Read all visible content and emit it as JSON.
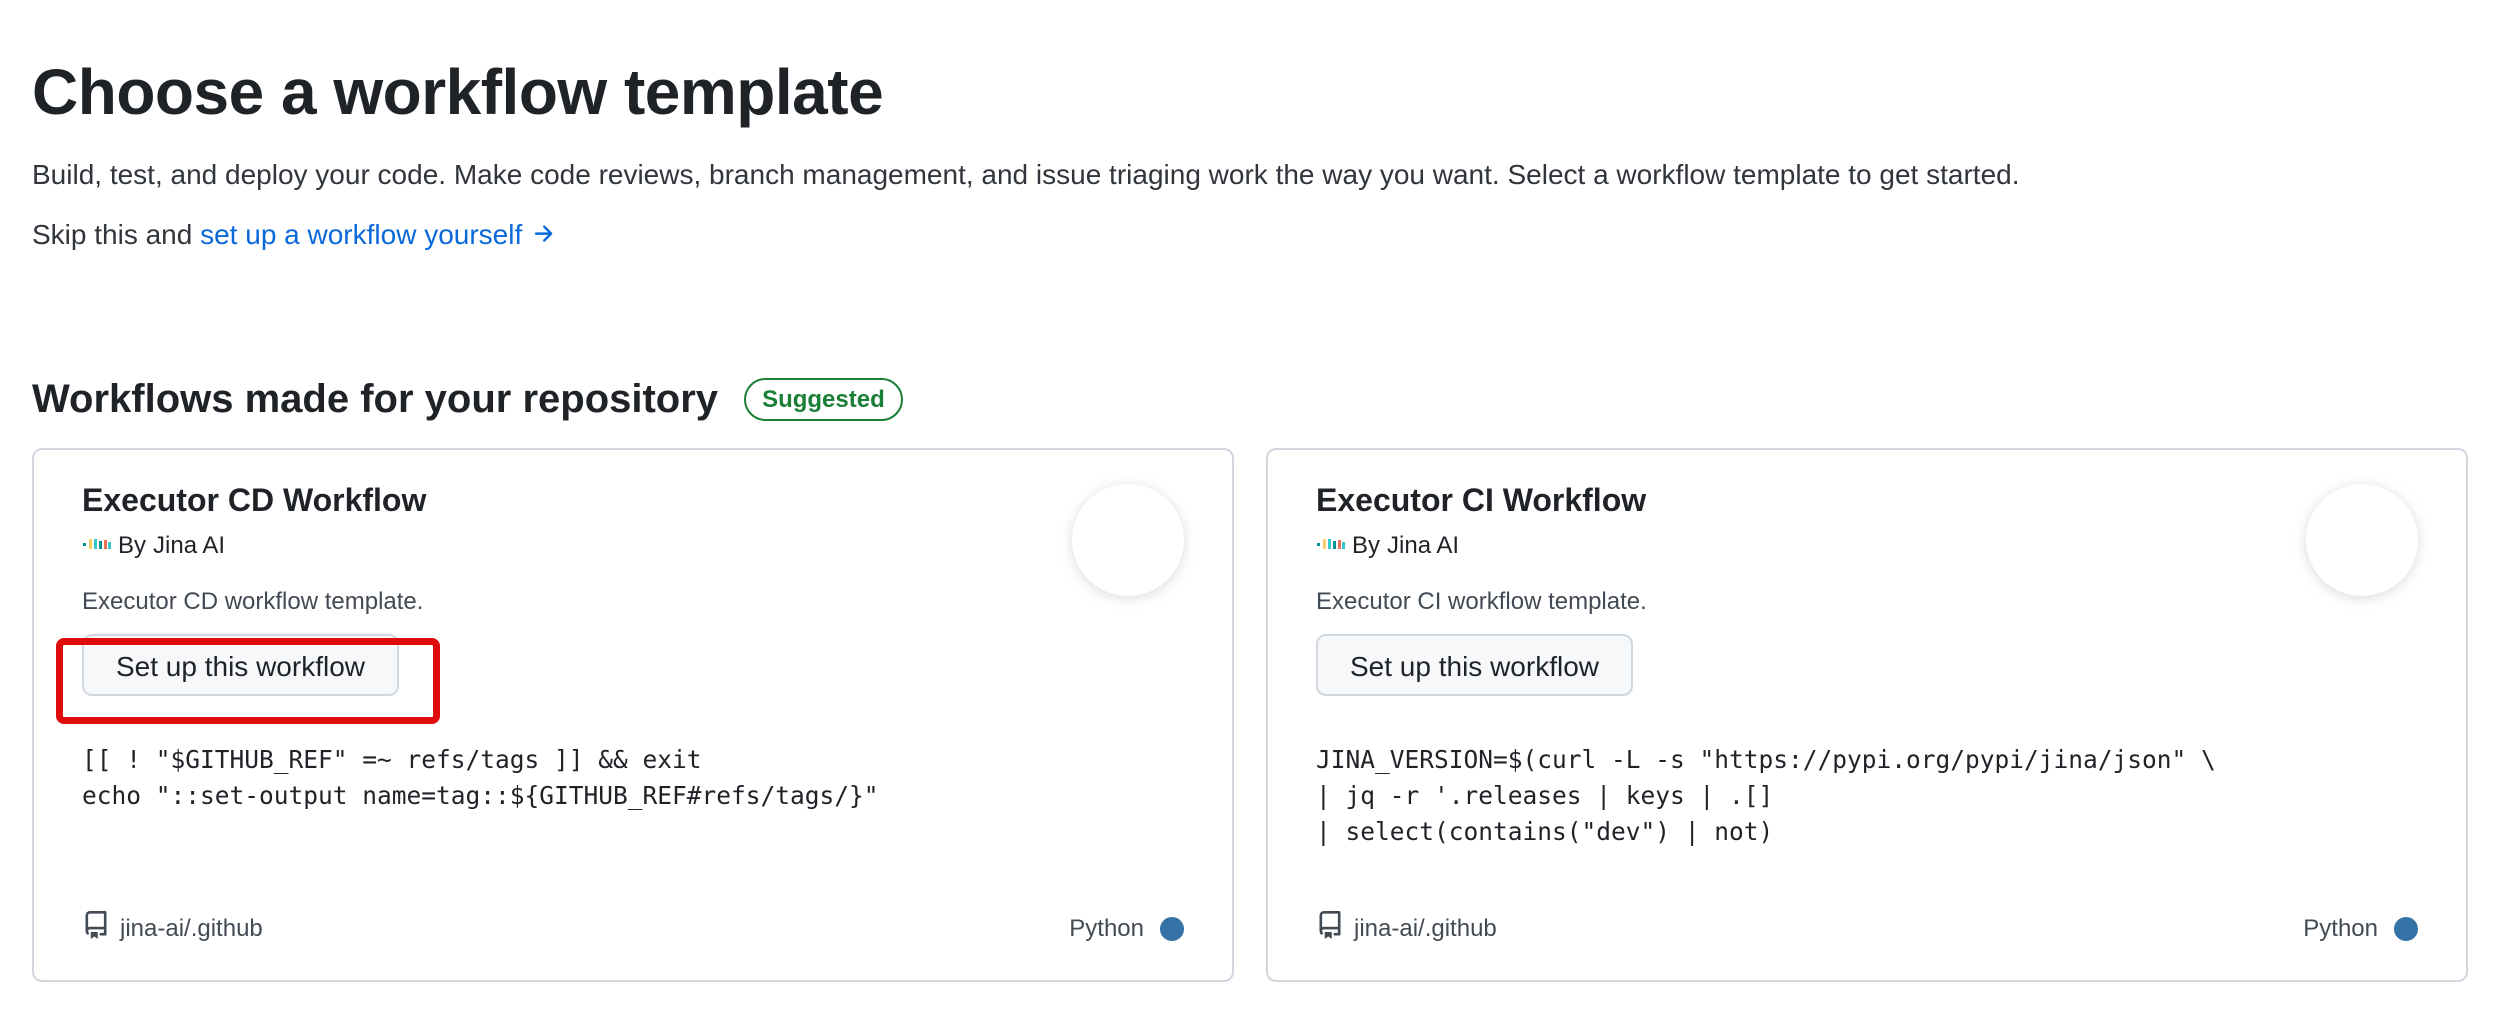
{
  "header": {
    "title": "Choose a workflow template",
    "description": "Build, test, and deploy your code. Make code reviews, branch management, and issue triaging work the way you want. Select a workflow template to get started.",
    "skip_prefix": "Skip this and",
    "skip_link": "set up a workflow yourself",
    "skip_icon": "arrow-right-icon"
  },
  "section": {
    "title": "Workflows made for your repository",
    "badge": "Suggested"
  },
  "colors": {
    "link": "#0969da",
    "badge": "#1a7f37",
    "python_dot": "#3572a5",
    "highlight": "#e00b0b"
  },
  "cards": [
    {
      "title": "Executor CD Workflow",
      "by": "By",
      "author": "Jina AI",
      "author_icon": "jina-logo-icon",
      "description": "Executor CD workflow template.",
      "button": "Set up this workflow",
      "code": "[[ ! \"$GITHUB_REF\" =~ refs/tags ]] && exit\necho \"::set-output name=tag::${GITHUB_REF#refs/tags/}\"",
      "repo": "jina-ai/.github",
      "repo_icon": "repo-icon",
      "language": "Python",
      "highlighted": true
    },
    {
      "title": "Executor CI Workflow",
      "by": "By",
      "author": "Jina AI",
      "author_icon": "jina-logo-icon",
      "description": "Executor CI workflow template.",
      "button": "Set up this workflow",
      "code": "JINA_VERSION=$(curl -L -s \"https://pypi.org/pypi/jina/json\" \\\n| jq -r '.releases | keys | .[]\n| select(contains(\"dev\") | not)",
      "repo": "jina-ai/.github",
      "repo_icon": "repo-icon",
      "language": "Python",
      "highlighted": false
    }
  ]
}
